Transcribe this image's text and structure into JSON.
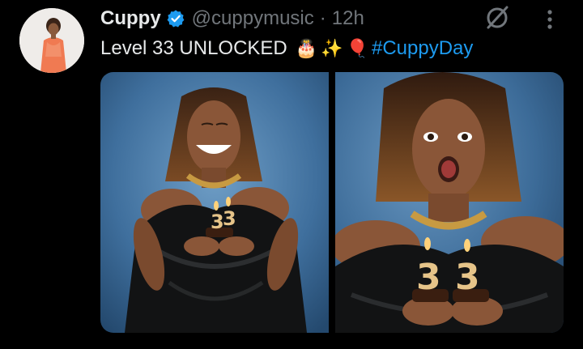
{
  "tweet": {
    "author": {
      "display_name": "Cuppy",
      "handle": "@cuppymusic",
      "separator": "·",
      "time": "12h",
      "avatar_icon": "profile-photo",
      "verified_icon": "verified-badge-icon"
    },
    "text": {
      "main": "Level 33 UNLOCKED",
      "emoji_cake": "🎂",
      "emoji_sparkles": "✨",
      "emoji_balloon": "🎈",
      "hashtag": "#CuppyDay"
    },
    "actions": {
      "grok_icon": "grok-icon",
      "more_icon": "more-options-icon"
    },
    "media": {
      "photo_count": 2
    },
    "colors": {
      "background": "#000000",
      "primary_text": "#e7e9ea",
      "secondary_text": "#71767b",
      "link": "#1d9bf0",
      "verified": "#1d9bf0"
    }
  }
}
